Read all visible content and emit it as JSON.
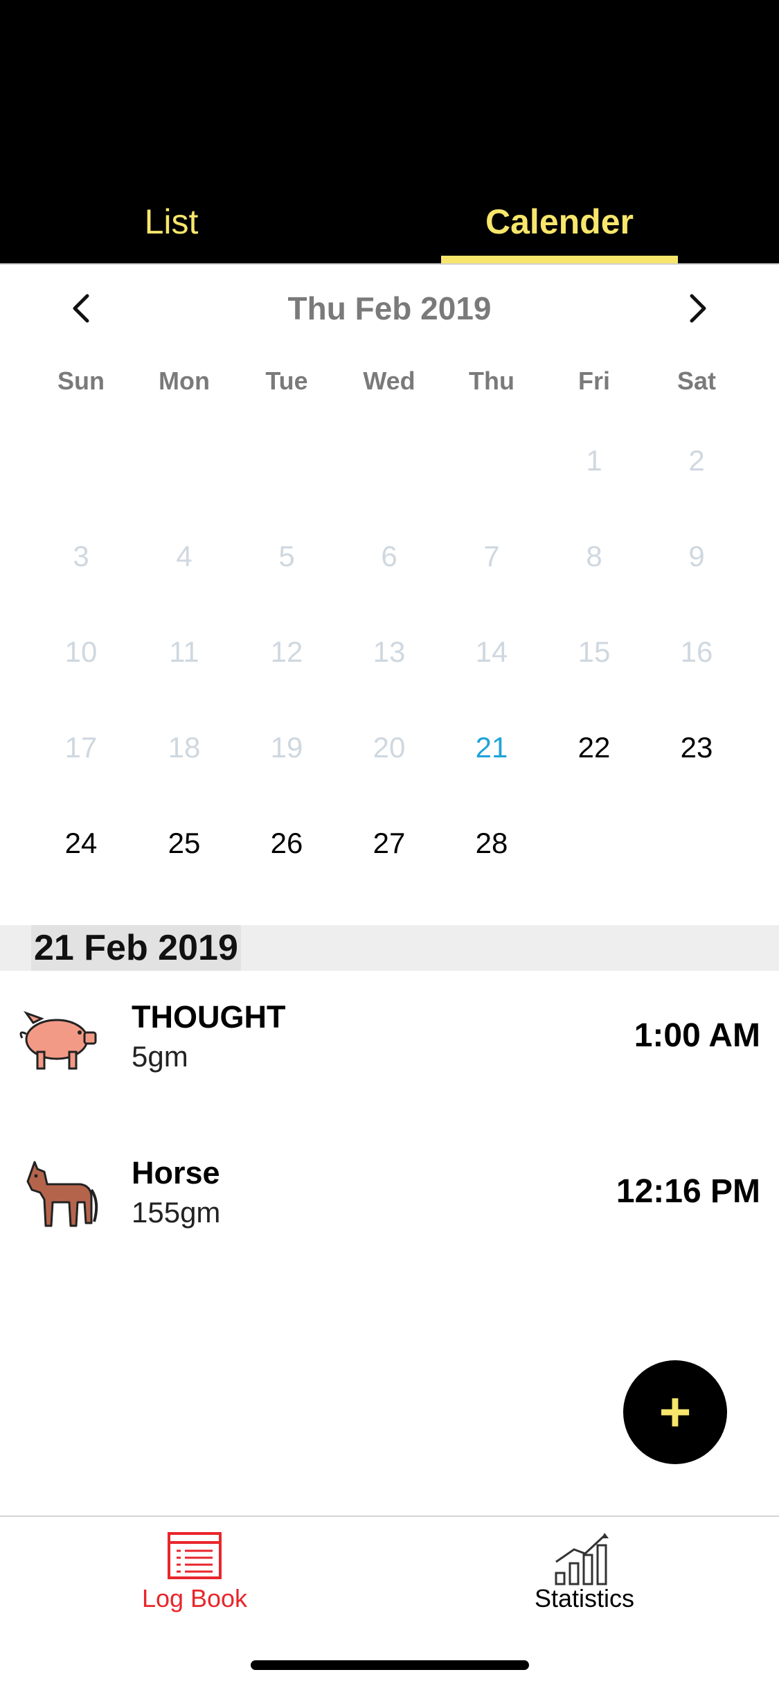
{
  "tabs": {
    "list_label": "List",
    "calendar_label": "Calender",
    "active": "calendar",
    "accent_color": "#f7e66b"
  },
  "calendar": {
    "month_title": "Thu Feb 2019",
    "prev_icon": "chevron-left-icon",
    "next_icon": "chevron-right-icon",
    "weekdays": [
      "Sun",
      "Mon",
      "Tue",
      "Wed",
      "Thu",
      "Fri",
      "Sat"
    ],
    "days": [
      {
        "label": "1",
        "state": "muted"
      },
      {
        "label": "2",
        "state": "muted"
      },
      {
        "label": "3",
        "state": "muted"
      },
      {
        "label": "4",
        "state": "muted"
      },
      {
        "label": "5",
        "state": "muted"
      },
      {
        "label": "6",
        "state": "muted"
      },
      {
        "label": "7",
        "state": "muted"
      },
      {
        "label": "8",
        "state": "muted"
      },
      {
        "label": "9",
        "state": "muted"
      },
      {
        "label": "10",
        "state": "muted"
      },
      {
        "label": "11",
        "state": "muted"
      },
      {
        "label": "12",
        "state": "muted"
      },
      {
        "label": "13",
        "state": "muted"
      },
      {
        "label": "14",
        "state": "muted"
      },
      {
        "label": "15",
        "state": "muted"
      },
      {
        "label": "16",
        "state": "muted"
      },
      {
        "label": "17",
        "state": "muted"
      },
      {
        "label": "18",
        "state": "muted"
      },
      {
        "label": "19",
        "state": "muted"
      },
      {
        "label": "20",
        "state": "muted"
      },
      {
        "label": "21",
        "state": "today"
      },
      {
        "label": "22",
        "state": "active"
      },
      {
        "label": "23",
        "state": "active"
      },
      {
        "label": "24",
        "state": "active"
      },
      {
        "label": "25",
        "state": "active"
      },
      {
        "label": "26",
        "state": "active"
      },
      {
        "label": "27",
        "state": "active"
      },
      {
        "label": "28",
        "state": "active"
      }
    ],
    "today_color": "#1fa3d9"
  },
  "selected_date": "21 Feb 2019",
  "entries": [
    {
      "name": "THOUGHT",
      "amount": "5gm",
      "time": "1:00 AM",
      "icon": "pig-icon"
    },
    {
      "name": "Horse",
      "amount": "155gm",
      "time": "12:16 PM",
      "icon": "horse-icon"
    }
  ],
  "fab": {
    "label": "+",
    "icon": "plus-icon"
  },
  "bottom_nav": {
    "logbook_label": "Log Book",
    "logbook_icon": "logbook-icon",
    "logbook_color": "#e8262b",
    "statistics_label": "Statistics",
    "statistics_icon": "statistics-icon"
  }
}
